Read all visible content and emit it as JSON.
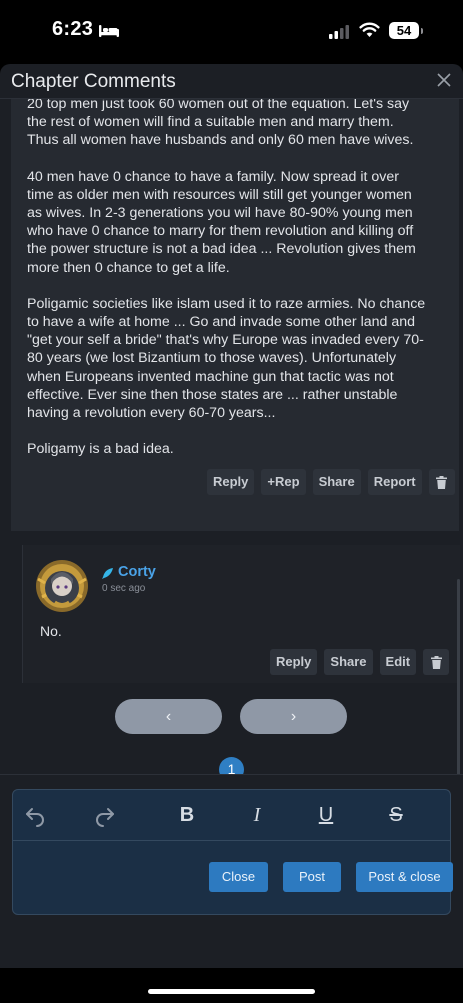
{
  "status_bar": {
    "time": "6:23",
    "battery": "54"
  },
  "modal": {
    "title": "Chapter Comments"
  },
  "parent_comment": {
    "paragraphs": [
      "20 top men just took 60 women out of the equation. Let's say the rest of women will find a suitable men and marry them. Thus all women have husbands and only 60 men have wives.",
      "40 men have 0 chance to have a family. Now spread it over time as older men with resources will still get younger women as wives. In 2-3 generations you wil have 80-90% young men who have 0 chance to marry for them revolution and killing off the power structure is not a bad idea ... Revolution gives them more then 0 chance to get a life.",
      "Poligamic societies like islam used it to raze armies. No chance to have a wife at home ... Go and invade some other land and \"get your self a bride\" that's why Europe was invaded every 70-80 years (we lost Bizantium to those waves). Unfortunately when Europeans invented machine gun that tactic was not effective. Ever sine then those states are ... rather unstable having a revolution every 60-70 years...",
      "Poligamy is a bad idea."
    ],
    "actions": {
      "reply": "Reply",
      "rep": "+Rep",
      "share": "Share",
      "report": "Report"
    }
  },
  "reply_comment": {
    "username": "Corty",
    "timestamp": "0 sec ago",
    "text": "No.",
    "actions": {
      "reply": "Reply",
      "share": "Share",
      "edit": "Edit"
    }
  },
  "pagination": {
    "prev_glyph": "‹",
    "next_glyph": "›",
    "current_page": "1"
  },
  "editor": {
    "toolbar": {
      "bold": "B",
      "italic": "I",
      "underline": "U",
      "strike": "S"
    },
    "value": ""
  },
  "buttons": {
    "close": "Close",
    "post": "Post",
    "post_close": "Post & close"
  },
  "colors": {
    "accent": "#2d7ac0",
    "username": "#4aa3e8",
    "modal_bg": "#1c1f25",
    "card_bg": "#262a31",
    "editor_bg": "#1b2f45"
  }
}
